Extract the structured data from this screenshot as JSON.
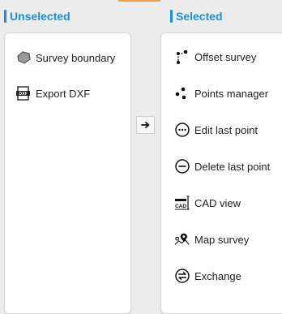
{
  "columns": {
    "unselected_title": "Unselected",
    "selected_title": "Selected"
  },
  "unselected_items": [
    {
      "label": "Survey boundary",
      "icon": "survey-boundary-icon"
    },
    {
      "label": "Export DXF",
      "icon": "dxf-file-icon"
    }
  ],
  "selected_items": [
    {
      "label": "Offset survey",
      "icon": "offset-survey-icon"
    },
    {
      "label": "Points manager",
      "icon": "points-manager-icon"
    },
    {
      "label": "Edit last point",
      "icon": "edit-last-point-icon"
    },
    {
      "label": "Delete last point",
      "icon": "delete-last-point-icon"
    },
    {
      "label": "CAD view",
      "icon": "cad-view-icon"
    },
    {
      "label": "Map survey",
      "icon": "map-survey-icon"
    },
    {
      "label": "Exchange",
      "icon": "exchange-icon"
    }
  ],
  "move_button": {
    "icon": "arrow-right-icon"
  },
  "colors": {
    "accent_blue": "#1f8fd8",
    "accent_orange": "#f0a040"
  }
}
